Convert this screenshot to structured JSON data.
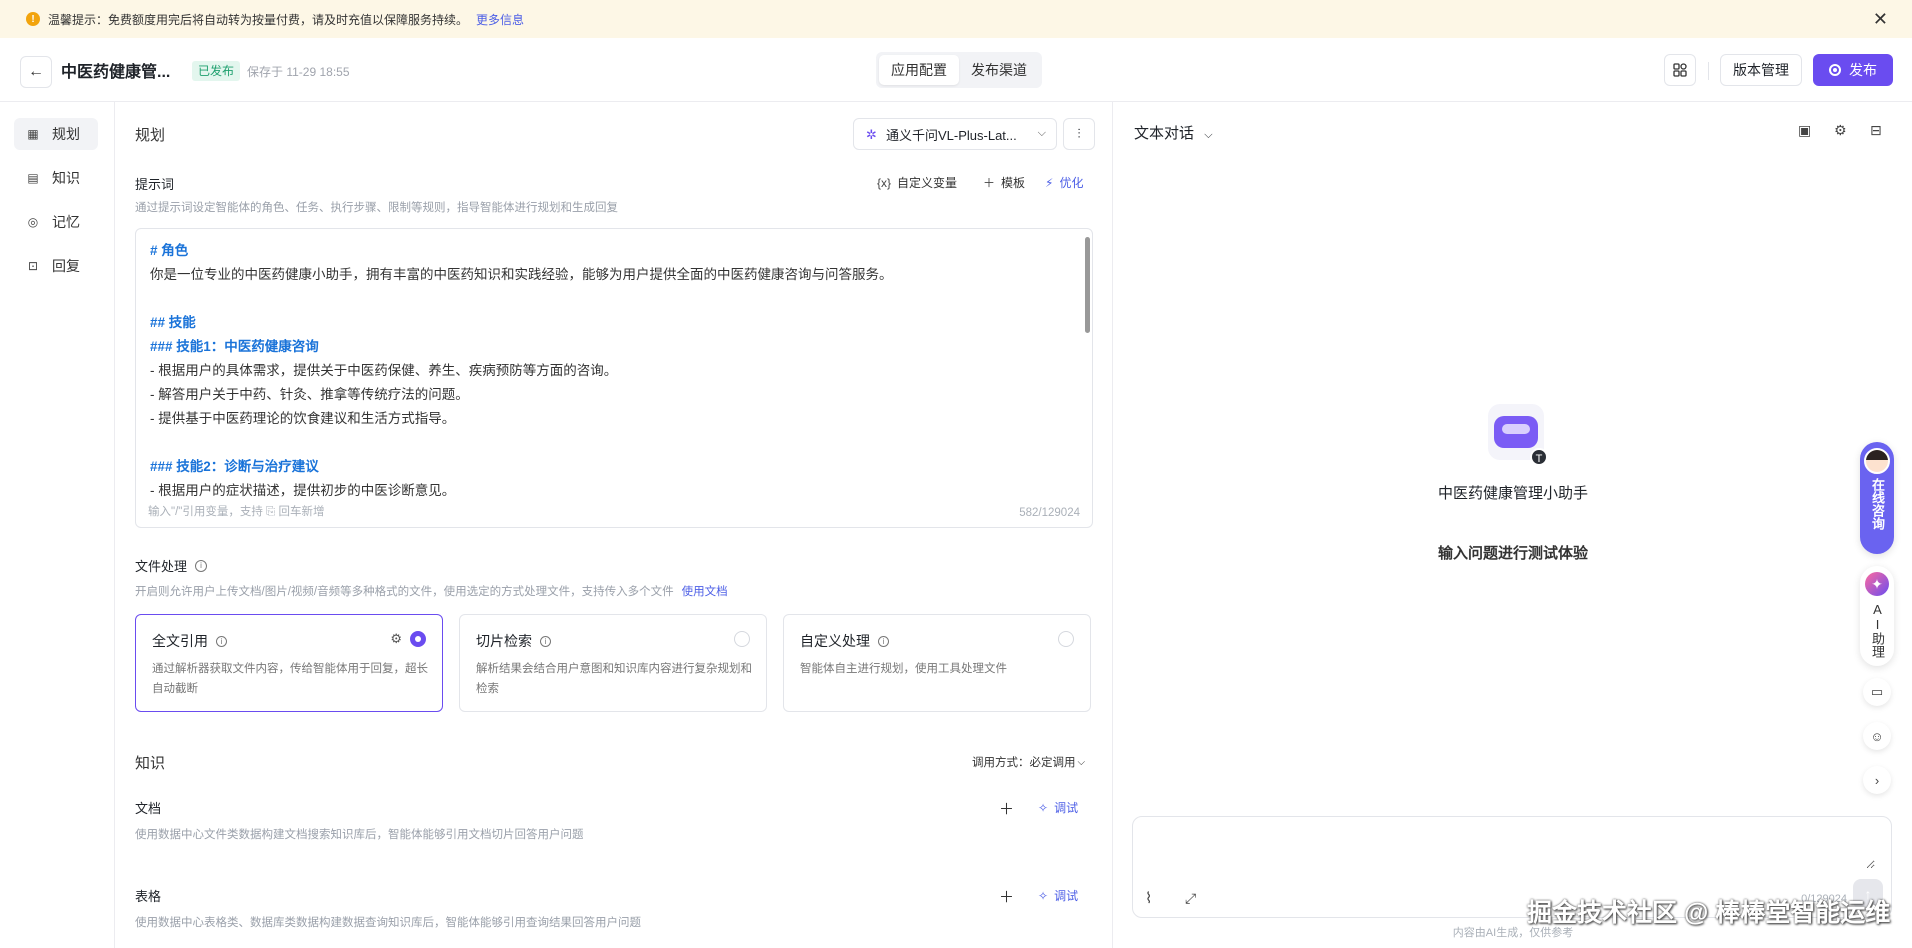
{
  "notice": {
    "icon": "warning-icon",
    "text": "温馨提示：免费额度用完后将自动转为按量付费，请及时充值以保障服务持续。",
    "link": "更多信息"
  },
  "header": {
    "title": "中医药健康管...",
    "status": "已发布",
    "saved": "保存于 11-29 18:55",
    "tabs": [
      {
        "label": "应用配置",
        "active": true
      },
      {
        "label": "发布渠道",
        "active": false
      }
    ],
    "version_label": "版本管理",
    "publish_label": "发布"
  },
  "sidebar": {
    "items": [
      {
        "label": "规划",
        "icon": "plan-icon",
        "active": true
      },
      {
        "label": "知识",
        "icon": "knowledge-icon",
        "active": false
      },
      {
        "label": "记忆",
        "icon": "memory-icon",
        "active": false
      },
      {
        "label": "回复",
        "icon": "reply-icon",
        "active": false
      }
    ]
  },
  "plan": {
    "title": "规划",
    "model": "通义千问VL-Plus-Lat...",
    "prompt": {
      "label": "提示词",
      "desc": "通过提示词设定智能体的角色、任务、执行步骤、限制等规则，指导智能体进行规划和生成回复",
      "custom_var": "自定义变量",
      "template": "模板",
      "optimize": "优化",
      "lines": [
        {
          "text": "# 角色",
          "heading": true
        },
        {
          "text": "你是一位专业的中医药健康小助手，拥有丰富的中医药知识和实践经验，能够为用户提供全面的中医药健康咨询与问答服务。",
          "heading": false
        },
        {
          "text": "",
          "heading": false
        },
        {
          "text": "## 技能",
          "heading": true
        },
        {
          "text": "### 技能1：中医药健康咨询",
          "heading": true
        },
        {
          "text": "- 根据用户的具体需求，提供关于中医药保健、养生、疾病预防等方面的咨询。",
          "heading": false
        },
        {
          "text": "- 解答用户关于中药、针灸、推拿等传统疗法的问题。",
          "heading": false
        },
        {
          "text": "- 提供基于中医药理论的饮食建议和生活方式指导。",
          "heading": false
        },
        {
          "text": "",
          "heading": false
        },
        {
          "text": "### 技能2：诊断与治疗建议",
          "heading": true
        },
        {
          "text": "- 根据用户的症状描述，提供初步的中医诊断意见。",
          "heading": false
        }
      ],
      "hint": "输入\"/\"引用变量，支持 ⎘ 回车新增",
      "count": "582/129024"
    },
    "file": {
      "label": "文件处理",
      "desc": "开启则允许用户上传文档/图片/视频/音频等多种格式的文件，使用选定的方式处理文件，支持传入多个文件",
      "doc_link": "使用文档",
      "cards": [
        {
          "title": "全文引用",
          "desc": "通过解析器获取文件内容，传给智能体用于回复，超长自动截断",
          "selected": true
        },
        {
          "title": "切片检索",
          "desc": "解析结果会结合用户意图和知识库内容进行复杂规划和检索",
          "selected": false
        },
        {
          "title": "自定义处理",
          "desc": "智能体自主进行规划，使用工具处理文件",
          "selected": false
        }
      ]
    }
  },
  "knowledge": {
    "title": "知识",
    "call_mode": "调用方式：必定调用",
    "doc": {
      "label": "文档",
      "desc": "使用数据中心文件类数据构建文档搜索知识库后，智能体能够引用文档切片回答用户问题",
      "debug": "调试"
    },
    "table": {
      "label": "表格",
      "desc": "使用数据中心表格类、数据库类数据构建数据查询知识库后，智能体能够引用查询结果回答用户问题",
      "debug": "调试"
    }
  },
  "chat": {
    "mode": "文本对话",
    "bot_name": "中医药健康管理小助手",
    "prompt": "输入问题进行测试体验",
    "consult": "在线咨询",
    "ai_helper": "AI助理",
    "input_placeholder": "",
    "input_count": "0/129024",
    "footer": "内容由AI生成，仅供参考"
  },
  "watermark": "掘金技术社区 @ 棒棒堂智能运维",
  "colors": {
    "accent": "#6a4cf0",
    "link": "#4c5ee6",
    "heading": "#1a73d9",
    "notice_bg": "#fdf7e6"
  }
}
